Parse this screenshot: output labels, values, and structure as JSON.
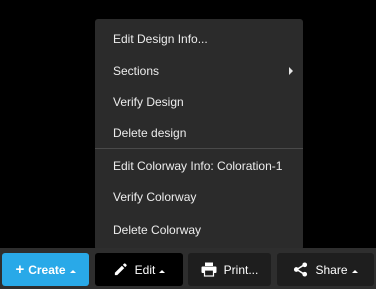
{
  "menu": {
    "items": [
      {
        "label": "Edit Design Info..."
      },
      {
        "label": "Sections"
      },
      {
        "label": "Verify Design"
      },
      {
        "label": "Delete design"
      },
      {
        "label": "Edit Colorway Info: Coloration-1"
      },
      {
        "label": "Verify Colorway"
      },
      {
        "label": "Delete Colorway"
      }
    ]
  },
  "toolbar": {
    "create_icon": "+",
    "create_label": "Create",
    "edit_label": "Edit",
    "print_label": "Print...",
    "share_label": "Share"
  },
  "colors": {
    "create_accent": "#29a9e8",
    "menu_background": "#2b2b2b"
  }
}
